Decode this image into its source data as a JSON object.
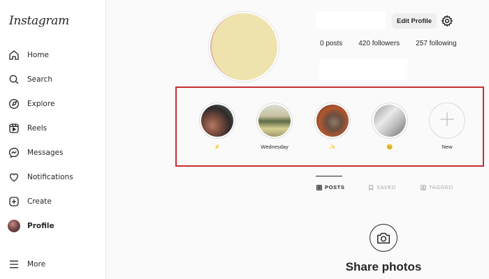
{
  "app": {
    "logo": "Instagram"
  },
  "sidebar": {
    "items": [
      {
        "label": "Home",
        "icon": "home-icon"
      },
      {
        "label": "Search",
        "icon": "search-icon"
      },
      {
        "label": "Explore",
        "icon": "compass-icon"
      },
      {
        "label": "Reels",
        "icon": "reels-icon"
      },
      {
        "label": "Messages",
        "icon": "messenger-icon"
      },
      {
        "label": "Notifications",
        "icon": "heart-icon"
      },
      {
        "label": "Create",
        "icon": "plus-square-icon"
      },
      {
        "label": "Profile",
        "icon": "avatar"
      }
    ],
    "more_label": "More"
  },
  "profile": {
    "edit_label": "Edit Profile",
    "stats": {
      "posts": "0 posts",
      "followers": "420 followers",
      "following": "257 following"
    }
  },
  "highlights": [
    {
      "caption": "⚡"
    },
    {
      "caption": "Wednesday"
    },
    {
      "caption": "✨"
    },
    {
      "caption": "😊"
    },
    {
      "caption": "New"
    }
  ],
  "tabs": [
    {
      "label": "POSTS",
      "icon": "grid-icon",
      "active": true
    },
    {
      "label": "SAVED",
      "icon": "bookmark-icon",
      "active": false
    },
    {
      "label": "TAGGED",
      "icon": "tag-icon",
      "active": false
    }
  ],
  "empty_state": {
    "title": "Share photos",
    "icon": "camera-icon"
  },
  "colors": {
    "highlight_frame": "#c72d33",
    "text": "#262626",
    "muted": "#a8a8a8"
  }
}
